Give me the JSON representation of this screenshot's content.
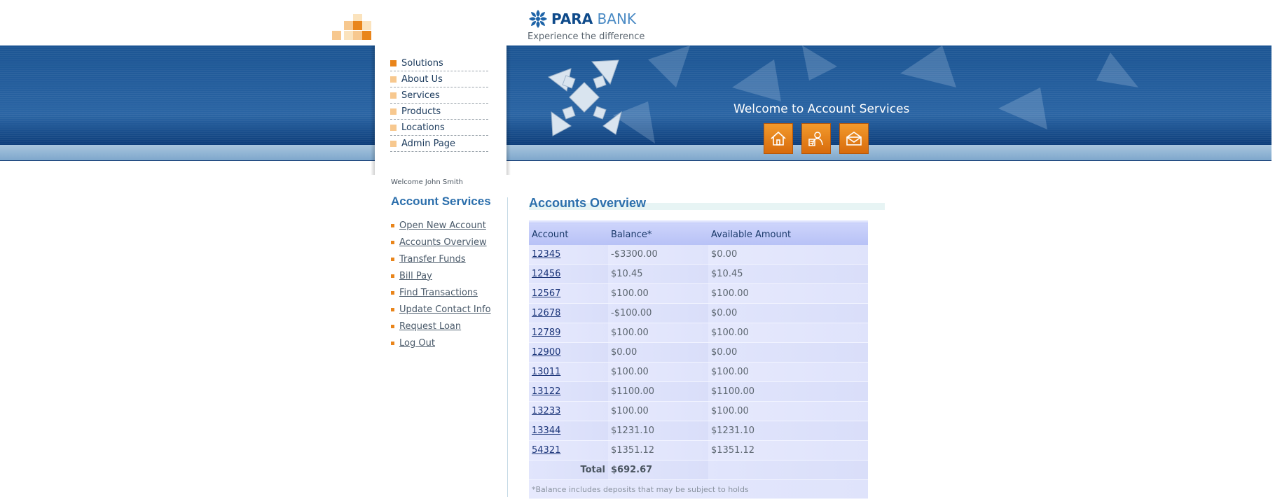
{
  "brand": {
    "name_bold": "PARA",
    "name_rest": " BANK",
    "tagline": "Experience the difference"
  },
  "top_menu": [
    {
      "label": "Solutions",
      "active": true
    },
    {
      "label": "About Us",
      "active": false
    },
    {
      "label": "Services",
      "active": false
    },
    {
      "label": "Products",
      "active": false
    },
    {
      "label": "Locations",
      "active": false
    },
    {
      "label": "Admin Page",
      "active": false
    }
  ],
  "banner": {
    "welcome": "Welcome to Account Services",
    "icons": [
      "home-icon",
      "contact-icon",
      "mail-icon"
    ]
  },
  "sidebar": {
    "welcome_user": "Welcome John Smith",
    "title": "Account Services",
    "links": [
      "Open New Account",
      "Accounts Overview",
      "Transfer Funds",
      "Bill Pay",
      "Find Transactions",
      "Update Contact Info",
      "Request Loan",
      "Log Out"
    ]
  },
  "main": {
    "title": "Accounts Overview",
    "table": {
      "headers": [
        "Account",
        "Balance*",
        "Available Amount"
      ],
      "rows": [
        [
          "12345",
          "-$3300.00",
          "$0.00"
        ],
        [
          "12456",
          "$10.45",
          "$10.45"
        ],
        [
          "12567",
          "$100.00",
          "$100.00"
        ],
        [
          "12678",
          "-$100.00",
          "$0.00"
        ],
        [
          "12789",
          "$100.00",
          "$100.00"
        ],
        [
          "12900",
          "$0.00",
          "$0.00"
        ],
        [
          "13011",
          "$100.00",
          "$100.00"
        ],
        [
          "13122",
          "$1100.00",
          "$1100.00"
        ],
        [
          "13233",
          "$100.00",
          "$100.00"
        ],
        [
          "13344",
          "$1231.10",
          "$1231.10"
        ],
        [
          "54321",
          "$1351.12",
          "$1351.12"
        ]
      ],
      "total_label": "Total",
      "total_value": "$692.67",
      "note": "*Balance includes deposits that may be subject to holds"
    }
  },
  "colors": {
    "accent_orange": "#e9851b",
    "brand_blue": "#2c6fac",
    "banner_blue": "#1c5593"
  }
}
